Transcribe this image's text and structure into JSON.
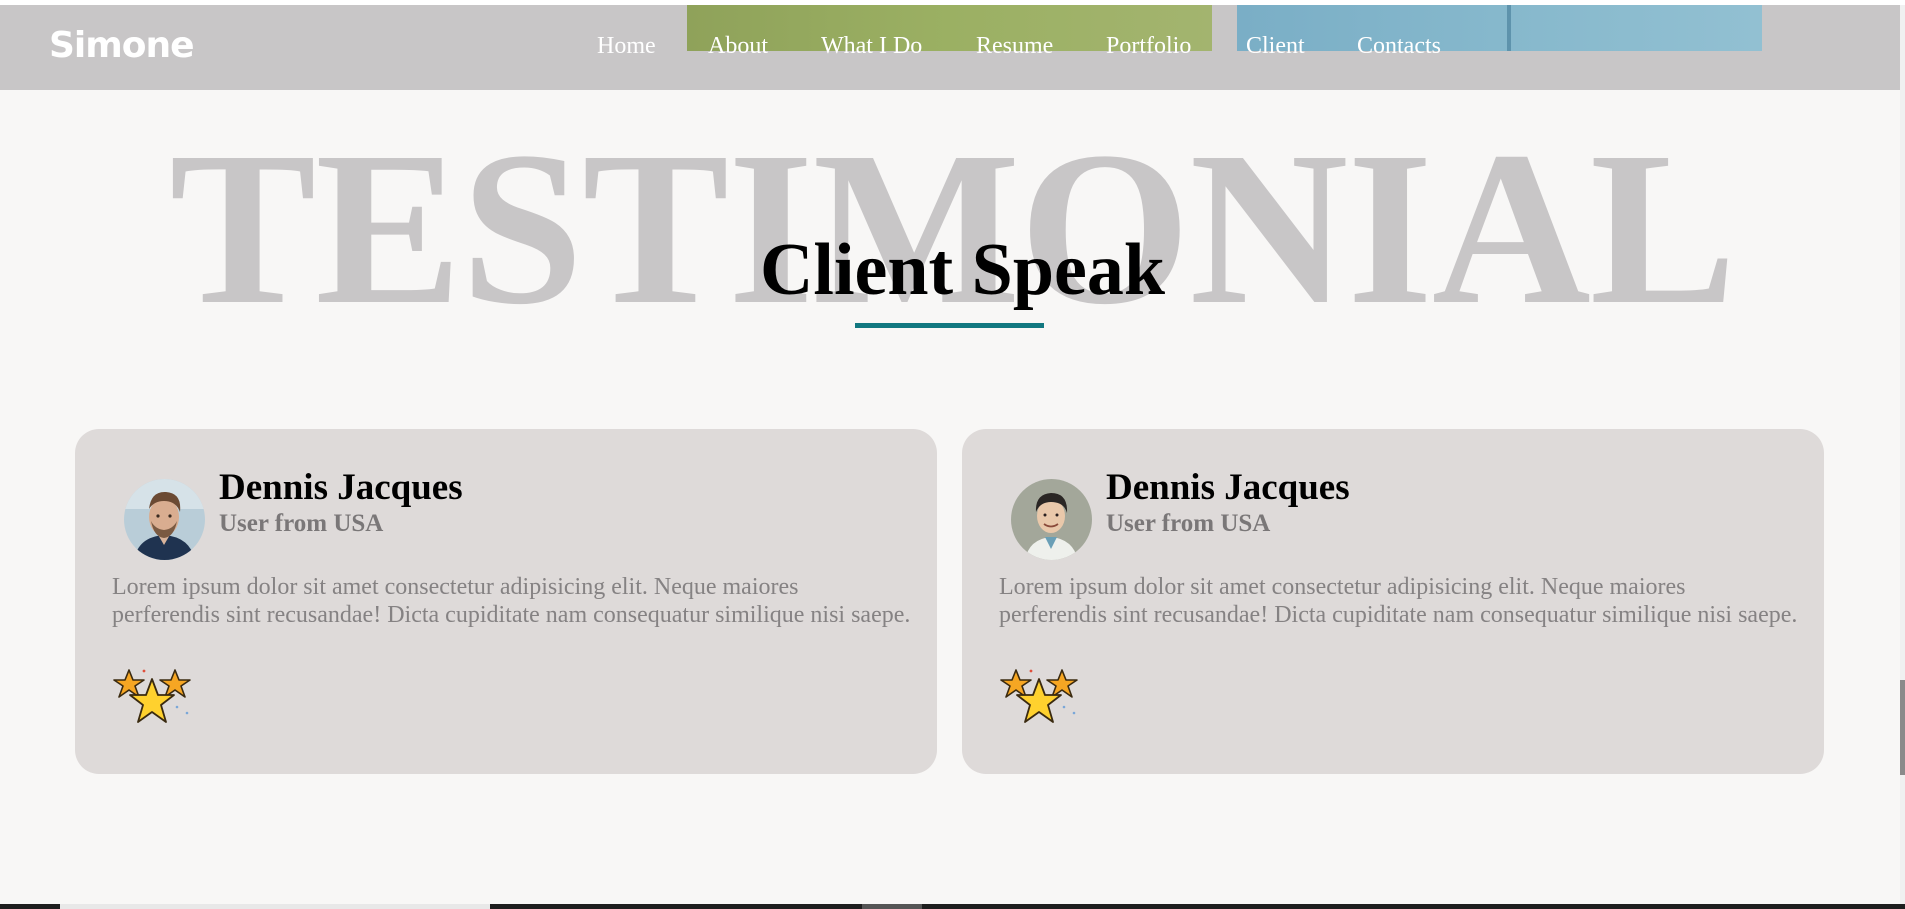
{
  "header": {
    "logo": "Simone",
    "nav": [
      {
        "label": "Home",
        "name": "nav-home"
      },
      {
        "label": "About",
        "name": "nav-about"
      },
      {
        "label": "What I Do",
        "name": "nav-what-i-do"
      },
      {
        "label": "Resume",
        "name": "nav-resume"
      },
      {
        "label": "Portfolio",
        "name": "nav-portfolio"
      },
      {
        "label": "Client",
        "name": "nav-client"
      },
      {
        "label": "Contacts",
        "name": "nav-contacts"
      }
    ]
  },
  "section": {
    "background_word": "TESTIMONIAL",
    "title": "Client Speak",
    "accent_color": "#127880"
  },
  "testimonials": [
    {
      "name": "Dennis Jacques",
      "role": "User from USA",
      "quote": "Lorem ipsum dolor sit amet consectetur adipisicing elit. Neque maiores perferendis sint recusandae! Dicta cupiditate nam consequatur similique nisi saepe.",
      "avatar": "man-with-beard-photo",
      "rating_icon": "stars-icon"
    },
    {
      "name": "Dennis Jacques",
      "role": "User from USA",
      "quote": "Lorem ipsum dolor sit amet consectetur adipisicing elit. Neque maiores perferendis sint recusandae! Dicta cupiditate nam consequatur similique nisi saepe.",
      "avatar": "smiling-man-photo",
      "rating_icon": "stars-icon"
    }
  ],
  "colors": {
    "header_bg": "#c8c6c7",
    "page_bg": "#f8f7f6",
    "card_bg": "#dedad9",
    "background_word": "#c8c6c7",
    "subtle_text": "#858283"
  }
}
